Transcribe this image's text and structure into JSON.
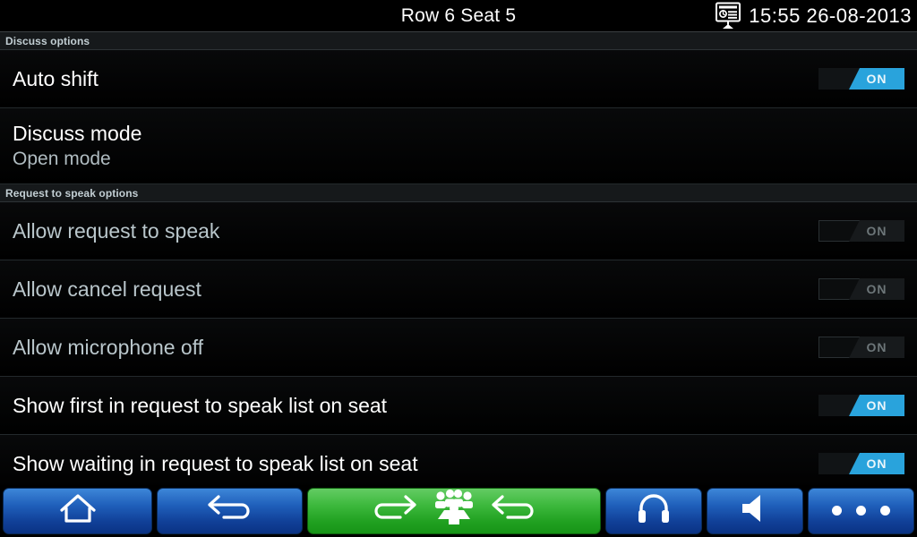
{
  "statusbar": {
    "title": "Row 6 Seat 5",
    "clock": "15:55 26-08-2013",
    "icon": "meeting-display-icon"
  },
  "sections": [
    {
      "header": "Discuss options",
      "rows": [
        {
          "title": "Auto shift",
          "subtitle": "",
          "control": "toggle",
          "toggle_label": "ON",
          "state": "on",
          "enabled": true
        },
        {
          "title": "Discuss mode",
          "subtitle": "Open mode",
          "control": "none"
        }
      ]
    },
    {
      "header": "Request to speak options",
      "rows": [
        {
          "title": "Allow request to speak",
          "subtitle": "",
          "control": "toggle",
          "toggle_label": "ON",
          "state": "on",
          "enabled": false
        },
        {
          "title": "Allow cancel request",
          "subtitle": "",
          "control": "toggle",
          "toggle_label": "ON",
          "state": "on",
          "enabled": false
        },
        {
          "title": "Allow microphone off",
          "subtitle": "",
          "control": "toggle",
          "toggle_label": "ON",
          "state": "on",
          "enabled": false
        },
        {
          "title": "Show first in request to speak list on seat",
          "subtitle": "",
          "control": "toggle",
          "toggle_label": "ON",
          "state": "on",
          "enabled": true
        },
        {
          "title": "Show waiting in request to speak list on seat",
          "subtitle": "",
          "control": "toggle",
          "toggle_label": "ON",
          "state": "on",
          "enabled": true
        }
      ]
    }
  ],
  "buttonbar": {
    "buttons": [
      {
        "name": "home-button",
        "icon": "home-icon",
        "color": "blue"
      },
      {
        "name": "back-button",
        "icon": "back-arrow-icon",
        "color": "blue"
      },
      {
        "name": "discussion-button",
        "icon": "discussion-group-icon",
        "color": "green"
      },
      {
        "name": "headphones-button",
        "icon": "headphones-icon",
        "color": "blue"
      },
      {
        "name": "speaker-button",
        "icon": "speaker-icon",
        "color": "blue"
      },
      {
        "name": "more-button",
        "icon": "more-dots-icon",
        "color": "blue"
      }
    ]
  },
  "colors": {
    "accent_blue": "#29a3dc",
    "button_blue": "#1f5fba",
    "button_green": "#3cb83c",
    "background": "#000000",
    "section_header_bg": "#16191b",
    "text_primary": "#ffffff",
    "text_dim": "#b9c6cb"
  }
}
